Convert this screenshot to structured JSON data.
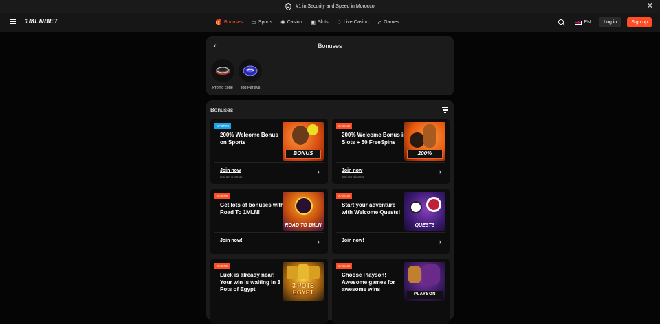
{
  "topbar": {
    "message": "#1 in Security and Speed in Morocco",
    "close_label": "✕"
  },
  "header": {
    "logo": "1MLNBET",
    "nav": [
      {
        "label": "Bonuses",
        "icon": "gift-icon",
        "glyph": "🎁",
        "active": true
      },
      {
        "label": "Sports",
        "icon": "ticket-icon",
        "glyph": "▭"
      },
      {
        "label": "Casino",
        "icon": "chip-icon",
        "glyph": "✺"
      },
      {
        "label": "Slots",
        "icon": "slots-icon",
        "glyph": "▣"
      },
      {
        "label": "Live Casino",
        "icon": "live-icon",
        "glyph": "♢"
      },
      {
        "label": "Games",
        "icon": "rocket-icon",
        "glyph": "➶"
      }
    ],
    "language": "EN",
    "login_label": "Log in",
    "signup_label": "Sign up"
  },
  "top_panel": {
    "title": "Bonuses",
    "back_glyph": "‹",
    "quick_links": [
      {
        "label": "Promo code",
        "icon": "promo-code-icon"
      },
      {
        "label": "Top Parlays",
        "icon": "top-parlays-icon"
      }
    ]
  },
  "bonuses_panel": {
    "title": "Bonuses",
    "cards": [
      {
        "tag": "SPORTS",
        "tag_type": "sports",
        "text": "200% Welcome Bonus on Sports",
        "action": "Join now",
        "sub": "and get a bonus",
        "image_label": "BONUS"
      },
      {
        "tag": "CASINO",
        "tag_type": "casino",
        "text": "200% Welcome Bonus in Slots + 50 FreeSpins",
        "action": "Join now",
        "sub": "and get a bonus",
        "image_label": "200%"
      },
      {
        "tag": "CASINO",
        "tag_type": "casino",
        "text": "Get lots of bonuses with Road To 1MLN!",
        "action": "Join now!",
        "sub": "",
        "image_label": "ROAD TO 1MLN"
      },
      {
        "tag": "CASINO",
        "tag_type": "casino",
        "text": "Start your adventure with Welcome Quests!",
        "action": "Join now!",
        "sub": "",
        "image_label": "QUESTS"
      },
      {
        "tag": "CASINO",
        "tag_type": "casino",
        "text": "Luck is already near! Your win is waiting in 3 Pots of Egypt",
        "action": "",
        "sub": "",
        "image_label": "3 POTS EGYPT"
      },
      {
        "tag": "CASINO",
        "tag_type": "casino",
        "text": "Choose Playson! Awesome games for awesome wins",
        "action": "",
        "sub": "",
        "image_label": "PLAYSON"
      }
    ]
  },
  "colors": {
    "accent": "#ff4d24",
    "sports_tag": "#1aa3e8",
    "panel_bg": "#1b1b1b",
    "card_bg": "#0d0d0d"
  }
}
